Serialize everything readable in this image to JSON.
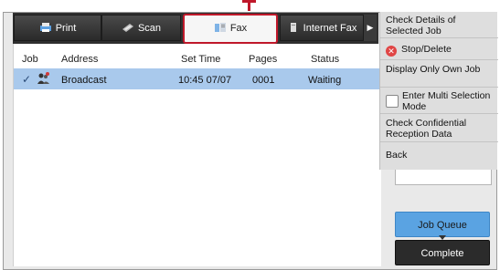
{
  "tabs": [
    {
      "label": "Print",
      "icon": "printer-icon"
    },
    {
      "label": "Scan",
      "icon": "scanner-icon"
    },
    {
      "label": "Fax",
      "icon": "fax-icon",
      "active": true
    },
    {
      "label": "Internet Fax",
      "icon": "internet-fax-icon"
    }
  ],
  "tab_more_glyph": "▶",
  "columns": [
    "Job",
    "Address",
    "Set Time",
    "Pages",
    "Status"
  ],
  "job_row": {
    "checkmark": "✓",
    "address": "Broadcast",
    "set_time": "10:45 07/07",
    "pages": "0001",
    "status": "Waiting"
  },
  "menu": [
    "Check Details of Selected Job",
    "Stop/Delete",
    "Display Only Own Job",
    "Enter Multi Selection Mode",
    "Check Confidential Reception Data",
    "Back"
  ],
  "buttons": {
    "job_queue": "Job Queue",
    "complete": "Complete"
  },
  "colors": {
    "highlight": "#c0182a",
    "selected_row": "#a9c9ec",
    "job_queue_button": "#5aa3e2"
  }
}
